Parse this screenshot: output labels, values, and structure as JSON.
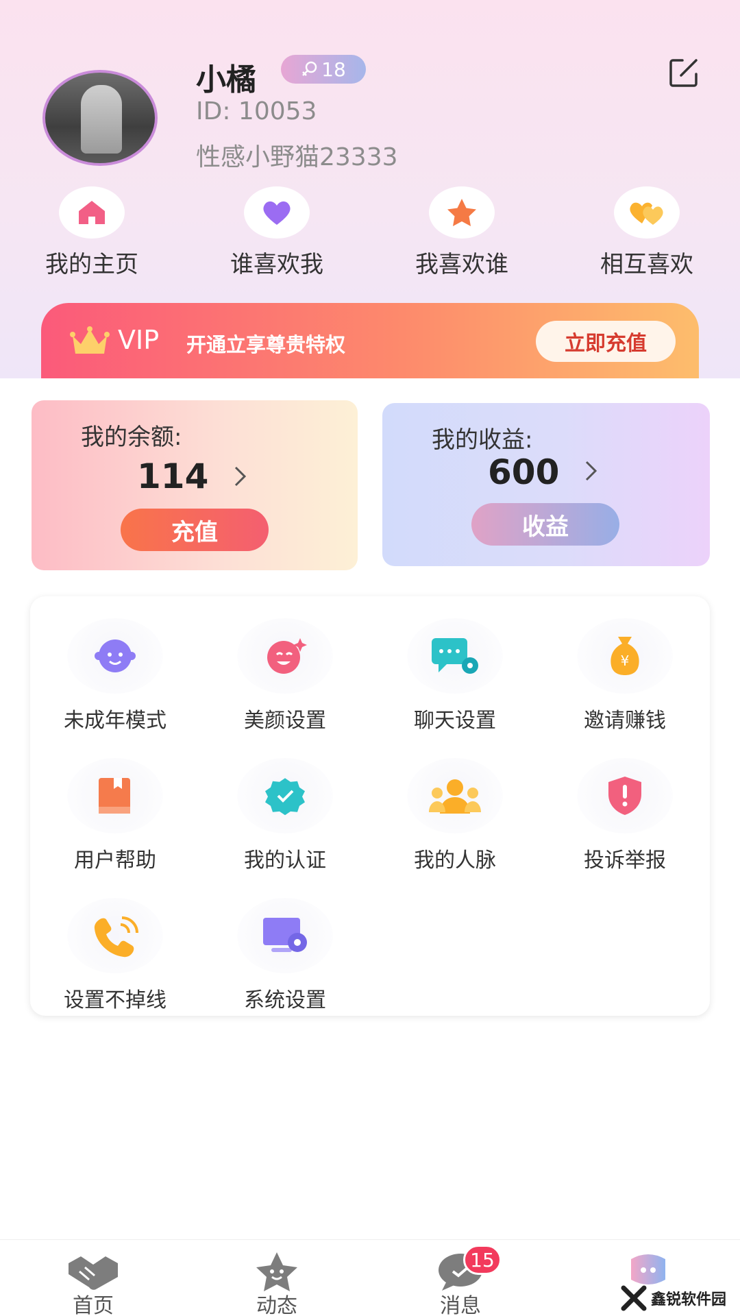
{
  "profile": {
    "name": "小橘",
    "age": "18",
    "id_text": "ID: 10053",
    "signature": "性感小野猫23333"
  },
  "quick_links": [
    {
      "label": "我的主页",
      "icon": "home-icon",
      "color": "#f25f86"
    },
    {
      "label": "谁喜欢我",
      "icon": "heart-icon",
      "color": "#9b6cf2"
    },
    {
      "label": "我喜欢谁",
      "icon": "star-icon",
      "color": "#f57a45"
    },
    {
      "label": "相互喜欢",
      "icon": "double-heart-icon",
      "color": "#fbb230"
    }
  ],
  "vip": {
    "label": "VIP",
    "desc": "开通立享尊贵特权",
    "button": "立即充值"
  },
  "balance": {
    "title": "我的余额:",
    "value": "114",
    "button": "充值"
  },
  "earnings": {
    "title": "我的收益:",
    "value": "600",
    "button": "收益"
  },
  "menu": [
    {
      "label": "未成年模式",
      "icon": "child-mode-icon",
      "color": "#8e7cf5"
    },
    {
      "label": "美颜设置",
      "icon": "beauty-icon",
      "color": "#f2607e"
    },
    {
      "label": "聊天设置",
      "icon": "chat-settings-icon",
      "color": "#2cc2c8"
    },
    {
      "label": "邀请赚钱",
      "icon": "money-bag-icon",
      "color": "#fbae28"
    },
    {
      "label": "用户帮助",
      "icon": "help-book-icon",
      "color": "#f57b4c"
    },
    {
      "label": "我的认证",
      "icon": "verified-icon",
      "color": "#2cc2c8"
    },
    {
      "label": "我的人脉",
      "icon": "contacts-icon",
      "color": "#fbae28"
    },
    {
      "label": "投诉举报",
      "icon": "report-shield-icon",
      "color": "#f2607e"
    },
    {
      "label": "设置不掉线",
      "icon": "phone-icon",
      "color": "#fbae28"
    },
    {
      "label": "系统设置",
      "icon": "system-settings-icon",
      "color": "#8e7cf5"
    }
  ],
  "tabs": [
    {
      "label": "首页",
      "icon": "handshake-icon"
    },
    {
      "label": "动态",
      "icon": "star-face-icon"
    },
    {
      "label": "消息",
      "icon": "message-icon",
      "badge": "15"
    },
    {
      "label": "",
      "icon": "profile-bubble-icon"
    }
  ],
  "watermark": {
    "text": "鑫锐软件园"
  }
}
